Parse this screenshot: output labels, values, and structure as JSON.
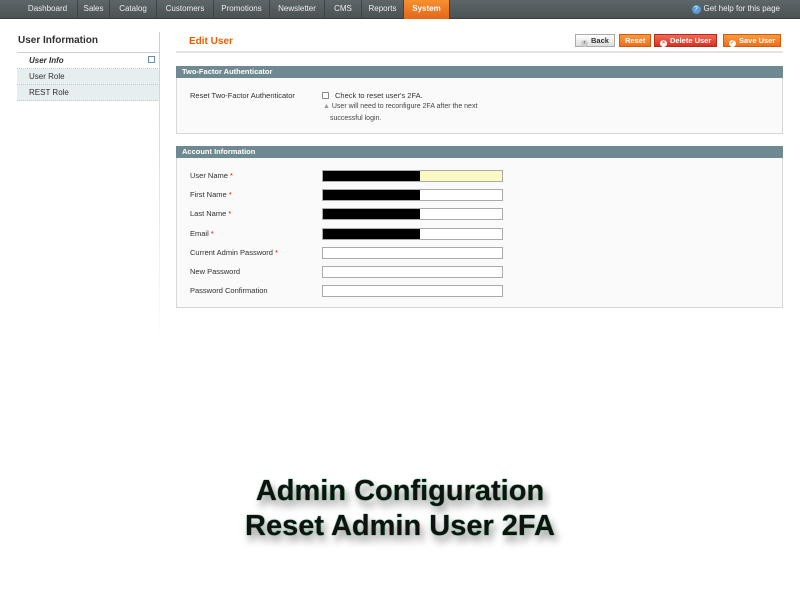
{
  "nav": {
    "items": [
      "Dashboard",
      "Sales",
      "Catalog",
      "Customers",
      "Promotions",
      "Newsletter",
      "CMS",
      "Reports",
      "System"
    ],
    "active": "System",
    "help": "Get help for this page"
  },
  "sidebar": {
    "title": "User Information",
    "items": [
      "User Info",
      "User Role",
      "REST Role"
    ]
  },
  "header": {
    "title": "Edit User",
    "buttons": {
      "back": "Back",
      "reset": "Reset",
      "delete": "Delete User",
      "save": "Save User"
    }
  },
  "two_factor": {
    "title": "Two-Factor Authenticator",
    "label": "Reset Two-Factor Authenticator",
    "checkbox_label": "Check to reset user's 2FA.",
    "note_line1": "User will need to reconfigure 2FA after the next",
    "note_line2": "successful login."
  },
  "account": {
    "title": "Account Information",
    "fields": [
      {
        "label": "User Name",
        "required": "*"
      },
      {
        "label": "First Name",
        "required": "*"
      },
      {
        "label": "Last Name",
        "required": "*"
      },
      {
        "label": "Email",
        "required": "*"
      },
      {
        "label": "Current Admin Password",
        "required": "*"
      },
      {
        "label": "New Password",
        "required": ""
      },
      {
        "label": "Password Confirmation",
        "required": ""
      }
    ]
  },
  "overlay": {
    "line1": "Admin Configuration",
    "line2": "Reset Admin User 2FA"
  },
  "colors": {
    "accent": "#eb5e00",
    "section": "#6f8992"
  }
}
